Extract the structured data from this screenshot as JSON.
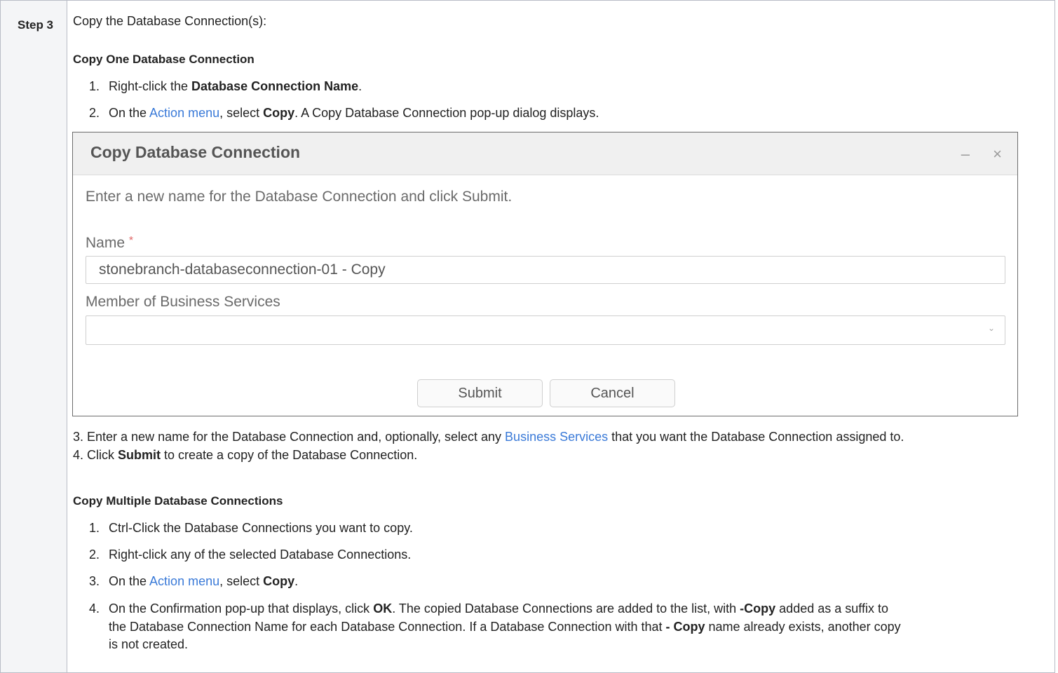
{
  "step_label": "Step 3",
  "intro": "Copy the Database Connection(s):",
  "copy_one": {
    "heading": "Copy One Database Connection",
    "items": [
      {
        "num": "1.",
        "pre": "Right-click the ",
        "bold": "Database Connection Name",
        "post": "."
      },
      {
        "num": "2.",
        "pre": "On the ",
        "link": "Action menu",
        "mid": ", select ",
        "bold": "Copy",
        "post": ". A Copy Database Connection pop-up dialog displays."
      }
    ]
  },
  "dialog": {
    "title": "Copy Database Connection",
    "minimize_glyph": "–",
    "close_glyph": "×",
    "instruction": "Enter a new name for the Database Connection and click Submit.",
    "name_label": "Name",
    "required_mark": "*",
    "name_value": "stonebranch-databaseconnection-01 - Copy",
    "business_services_label": "Member of Business Services",
    "business_services_value": "",
    "dropdown_glyph": "⌄",
    "submit_label": "Submit",
    "cancel_label": "Cancel"
  },
  "after_dialog": {
    "line3_pre": "3. Enter a new name for the Database Connection and, optionally, select any ",
    "line3_link": "Business Services",
    "line3_post": " that you want the Database Connection assigned to.",
    "line4_pre": "4. Click ",
    "line4_bold": "Submit",
    "line4_post": " to create a copy of the Database Connection."
  },
  "copy_multiple": {
    "heading": "Copy Multiple Database Connections",
    "item1": {
      "num": "1.",
      "text": "Ctrl-Click the Database Connections you want to copy."
    },
    "item2": {
      "num": "2.",
      "text": "Right-click any of the selected Database Connections."
    },
    "item3": {
      "num": "3.",
      "pre": "On the ",
      "link": "Action menu",
      "mid": ", select ",
      "bold": "Copy",
      "post": "."
    },
    "item4": {
      "num": "4.",
      "l1_pre": "On the Confirmation pop-up that displays, click ",
      "l1_bold1": "OK",
      "l1_mid": ". The copied Database Connections are added to the list, with ",
      "l1_bold2": "-Copy",
      "l1_post": " added as a suffix to",
      "l2_pre": "the Database Connection Name for each Database Connection. If a Database Connection with that ",
      "l2_bold": "- Copy",
      "l2_post": " name already exists, another copy",
      "l3": "is not created."
    }
  }
}
